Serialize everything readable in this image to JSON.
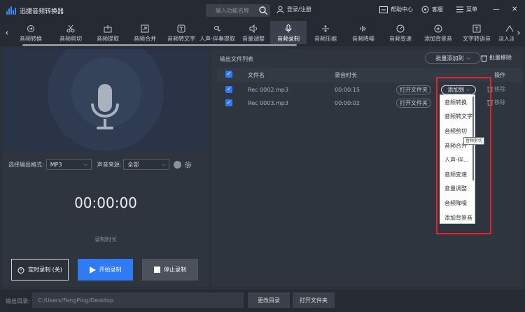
{
  "app": {
    "title": "迅捷音频转换器",
    "search_placeholder": "输入功能名称",
    "login": "登录/注册",
    "help": "帮助中心",
    "service": "客服",
    "menu": "菜单",
    "minimize": "—",
    "close": "✕"
  },
  "tabs": [
    {
      "label": "音频转换",
      "icon": "convert-icon"
    },
    {
      "label": "音频剪切",
      "icon": "scissors-icon"
    },
    {
      "label": "音频提取",
      "icon": "extract-icon"
    },
    {
      "label": "音频合并",
      "icon": "merge-icon"
    },
    {
      "label": "音频转文字",
      "icon": "text-icon"
    },
    {
      "label": "人声-伴奏提取",
      "icon": "vocal-icon"
    },
    {
      "label": "音量调整",
      "icon": "volume-icon"
    },
    {
      "label": "音频录制",
      "icon": "mic-icon",
      "active": true
    },
    {
      "label": "音频压缩",
      "icon": "compress-icon"
    },
    {
      "label": "音频降噪",
      "icon": "denoise-icon"
    },
    {
      "label": "音频变速",
      "icon": "speed-icon"
    },
    {
      "label": "添加背景音",
      "icon": "bgm-icon"
    },
    {
      "label": "文字转语音",
      "icon": "tts-icon"
    },
    {
      "label": "淡入淡出",
      "icon": "fade-icon"
    }
  ],
  "record": {
    "format_label": "选择输出格式:",
    "format_value": "MP3",
    "source_label": "声音来源:",
    "source_value": "全部",
    "timer": "00:00:00",
    "duration_label": "录制时长",
    "timer_button": "定时录制 (关)",
    "start_button": "开始录制",
    "stop_button": "停止录制"
  },
  "output": {
    "title": "输出文件列表",
    "batch_add": "批量添加到",
    "batch_remove": "批量移除",
    "columns": {
      "name": "文件名",
      "duration": "录音时长",
      "actions": "操作"
    },
    "rows": [
      {
        "name": "Rec 0002.mp3",
        "duration": "00:00:15",
        "open": "打开文件夹",
        "add_to": "添加到",
        "remove": "移除"
      },
      {
        "name": "Rec 0003.mp3",
        "duration": "00:00:02",
        "open": "打开文件夹",
        "add_to": "添加到",
        "remove": "移除"
      }
    ]
  },
  "dropdown": {
    "items": [
      "音频转换",
      "音频转文字",
      "音频剪切",
      "音频合并",
      "人声-伴...",
      "音频变速",
      "音量调整",
      "音频降噪",
      "添加背景音"
    ],
    "tooltip": "音频剪切"
  },
  "bottom": {
    "label": "输出目录:",
    "path": "C:/Users/FengPing/Desktop",
    "change_dir": "更改目录",
    "open_folder": "打开文件夹"
  },
  "colors": {
    "accent": "#2f7bf5",
    "highlight": "#e4252b",
    "background": "#2b3139"
  }
}
